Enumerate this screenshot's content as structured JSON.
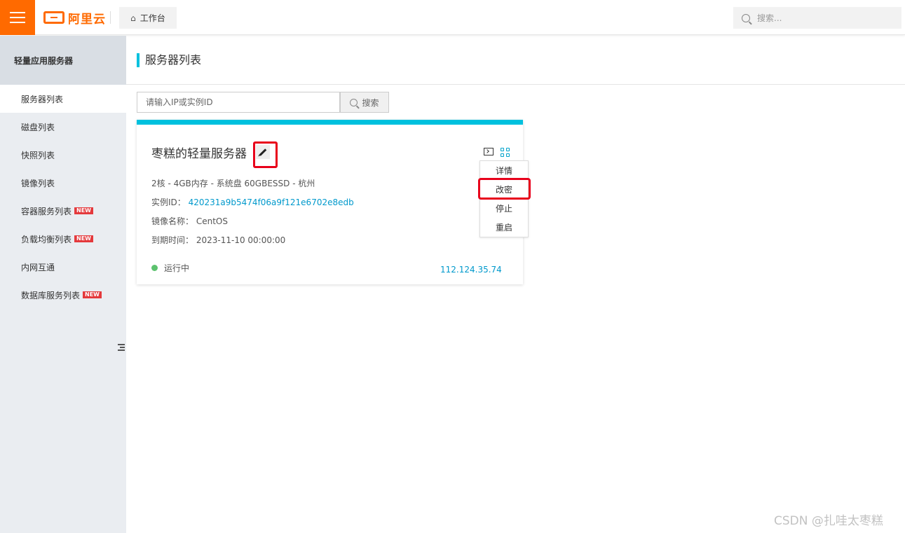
{
  "header": {
    "logo_text": "阿里云",
    "workbench_label": "工作台",
    "search_placeholder": "搜索..."
  },
  "sidebar": {
    "title": "轻量应用服务器",
    "items": [
      {
        "label": "服务器列表",
        "new": false
      },
      {
        "label": "磁盘列表",
        "new": false
      },
      {
        "label": "快照列表",
        "new": false
      },
      {
        "label": "镜像列表",
        "new": false
      },
      {
        "label": "容器服务列表",
        "new": true
      },
      {
        "label": "负载均衡列表",
        "new": true
      },
      {
        "label": "内网互通",
        "new": false
      },
      {
        "label": "数据库服务列表",
        "new": true
      }
    ],
    "new_badge": "NEW"
  },
  "main": {
    "title": "服务器列表",
    "search_placeholder": "请输入IP或实例ID",
    "search_button": "搜索"
  },
  "server": {
    "name": "枣糕的轻量服务器",
    "spec": "2核 - 4GB内存 - 系统盘 60GBESSD - 杭州",
    "instance_label": "实例ID：",
    "instance_id": "420231a9b5474f06a9f121e6702e8edb",
    "image_label": "镜像名称：",
    "image_value": "CentOS",
    "expire_label": "到期时间：",
    "expire_value": "2023-11-10 00:00:00",
    "status": "运行中",
    "ip": "112.124.35.74",
    "menu": [
      "详情",
      "改密",
      "停止",
      "重启"
    ]
  },
  "watermark": "CSDN @扎哇太枣糕",
  "colors": {
    "brand": "#ff6a00",
    "accent": "#00c1de",
    "link": "#0099cc",
    "highlight": "#e8001b",
    "running": "#5cc26e"
  }
}
